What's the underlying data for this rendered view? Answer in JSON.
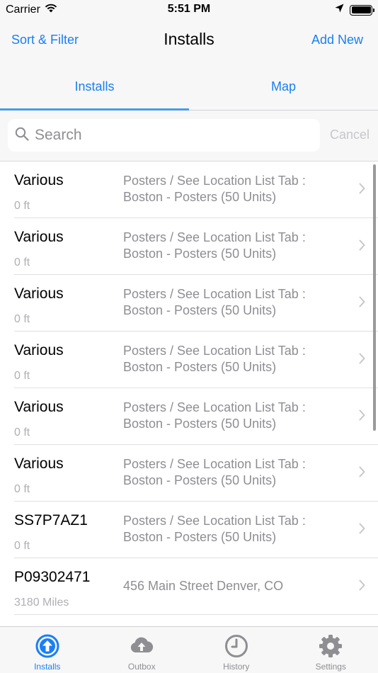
{
  "status_bar": {
    "carrier": "Carrier",
    "time": "5:51 PM"
  },
  "nav": {
    "left": "Sort & Filter",
    "title": "Installs",
    "right": "Add New"
  },
  "segments": {
    "installs": "Installs",
    "map": "Map",
    "selected": "Installs"
  },
  "search": {
    "placeholder": "Search",
    "value": "",
    "cancel": "Cancel"
  },
  "rows": [
    {
      "title": "Various",
      "distance": "0 ft",
      "desc1": "Posters / See Location List Tab :",
      "desc2": "Boston - Posters (50 Units)"
    },
    {
      "title": "Various",
      "distance": "0 ft",
      "desc1": "Posters / See Location List Tab :",
      "desc2": "Boston - Posters (50 Units)"
    },
    {
      "title": "Various",
      "distance": "0 ft",
      "desc1": "Posters / See Location List Tab :",
      "desc2": "Boston - Posters (50 Units)"
    },
    {
      "title": "Various",
      "distance": "0 ft",
      "desc1": "Posters / See Location List Tab :",
      "desc2": "Boston - Posters (50 Units)"
    },
    {
      "title": "Various",
      "distance": "0 ft",
      "desc1": "Posters / See Location List Tab :",
      "desc2": "Boston - Posters (50 Units)"
    },
    {
      "title": "Various",
      "distance": "0 ft",
      "desc1": "Posters / See Location List Tab :",
      "desc2": "Boston - Posters (50 Units)"
    },
    {
      "title": "SS7P7AZ1",
      "distance": "0 ft",
      "desc1": "Posters / See Location List Tab :",
      "desc2": "Boston - Posters (50 Units)"
    },
    {
      "title": "P09302471",
      "distance": "3180 Miles",
      "desc1": "456 Main Street Denver, CO",
      "desc2": ""
    }
  ],
  "tab_bar": {
    "items": [
      {
        "label": "Installs",
        "icon": "arrow-up-circle-icon",
        "active": true
      },
      {
        "label": "Outbox",
        "icon": "cloud-upload-icon",
        "active": false
      },
      {
        "label": "History",
        "icon": "clock-icon",
        "active": false
      },
      {
        "label": "Settings",
        "icon": "gear-icon",
        "active": false
      }
    ]
  },
  "colors": {
    "accent": "#1a7ff5",
    "inactive": "#8e8e93",
    "bar_background": "#f7f7f7"
  }
}
